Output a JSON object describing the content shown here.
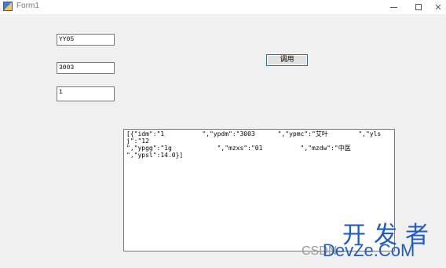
{
  "window": {
    "title": "Form1",
    "close_glyph": "✕"
  },
  "inputs": {
    "field1": "YY05",
    "field2": "3003",
    "field3": "1"
  },
  "call_button": {
    "label": "调用"
  },
  "output": {
    "text": "[{\"idm\":\"1          \",\"ypdm\":\"3003      \",\"ypmc\":\"艾叶        \",\"ylsj\":\"12\n\",\"ypgg\":\"1g            \",\"mzxs\":\"01          \",\"mzdw\":\"中医\n\",\"ypsl\":14.0}]"
  },
  "watermark": {
    "cn": "开发者",
    "csdn": "CSDN",
    "en": "DevZe.CoM"
  }
}
